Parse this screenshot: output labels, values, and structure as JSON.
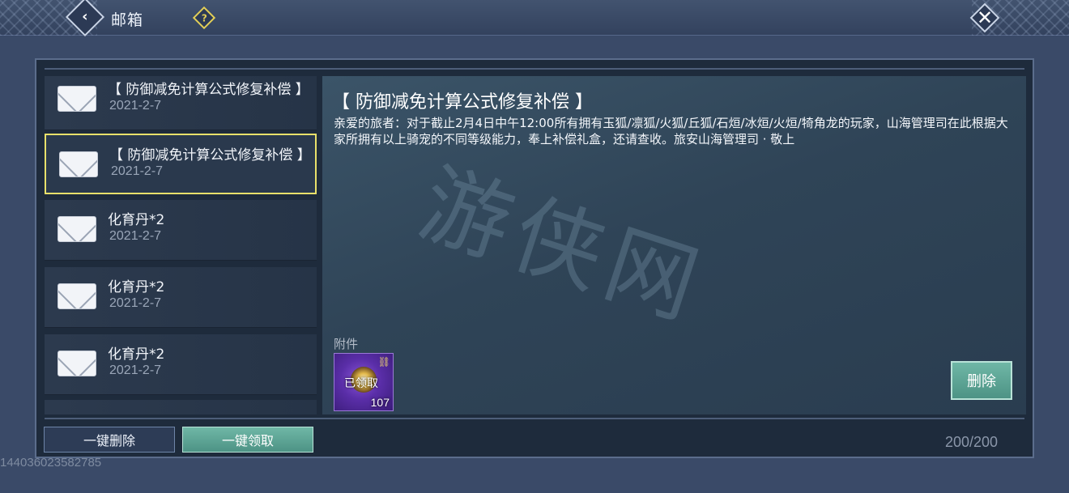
{
  "header": {
    "title": "邮箱",
    "back_icon": "chevron-left-icon",
    "help_glyph": "?",
    "close_glyph": "✕"
  },
  "mail_list": [
    {
      "subject": "【 防御减免计算公式修复补偿 】",
      "date": "2021-2-7",
      "selected": false
    },
    {
      "subject": "【 防御减免计算公式修复补偿 】",
      "date": "2021-2-7",
      "selected": true
    },
    {
      "subject": "化育丹*2",
      "date": "2021-2-7",
      "selected": false
    },
    {
      "subject": "化育丹*2",
      "date": "2021-2-7",
      "selected": false
    },
    {
      "subject": "化育丹*2",
      "date": "2021-2-7",
      "selected": false
    }
  ],
  "detail": {
    "title": "【 防御减免计算公式修复补偿 】",
    "body": "亲爱的旅者：对于截止2月4日中午12:00所有拥有玉狐/凛狐/火狐/丘狐/石烜/冰烜/火烜/犄角龙的玩家，山海管理司在此根据大家所拥有以上骑宠的不同等级能力，奉上补偿礼盒，还请查收。旅安山海管理司 · 敬上",
    "watermark": "游侠网",
    "attachment_label": "附件",
    "attachment": {
      "status": "已领取",
      "count": "107"
    },
    "delete_label": "删除"
  },
  "footer": {
    "delete_all_label": "一键删除",
    "claim_all_label": "一键领取",
    "mail_count": "200/200",
    "user_id": "1440360235827​85"
  },
  "colors": {
    "selected_border": "#e8e06a",
    "accent_button": "#5fa696",
    "panel_bg": "#1e2b3c"
  }
}
